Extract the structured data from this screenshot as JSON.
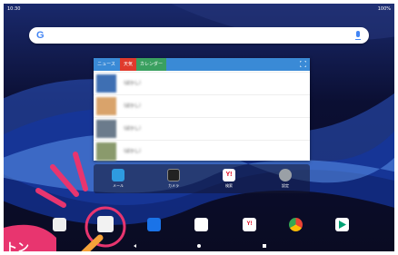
{
  "status_bar": {
    "time": "10:30",
    "battery": "100%"
  },
  "search": {
    "logo": "G"
  },
  "news_widget": {
    "tabs": [
      "ニュース",
      "天気",
      "カレンダー"
    ],
    "headlines": [
      "（ぼかし）",
      "（ぼかし）",
      "（ぼかし）",
      "（ぼかし）"
    ]
  },
  "apps": [
    {
      "label": "メール",
      "icon": "mail-icon"
    },
    {
      "label": "カメラ",
      "icon": "camera-icon"
    },
    {
      "label": "検索",
      "icon": "yahoo-icon"
    },
    {
      "label": "設定",
      "icon": "settings-icon"
    }
  ],
  "dock": [
    {
      "icon": "widgets-icon"
    },
    {
      "icon": "app-drawer-icon"
    },
    {
      "icon": "video-icon"
    },
    {
      "icon": "play-icon"
    },
    {
      "icon": "yahoo-icon"
    },
    {
      "icon": "chrome-icon"
    },
    {
      "icon": "play-store-icon"
    }
  ],
  "callout": {
    "text": "トン"
  },
  "colors": {
    "accent": "#3a8ad6",
    "red": "#e03a2c",
    "green": "#3aa060"
  }
}
